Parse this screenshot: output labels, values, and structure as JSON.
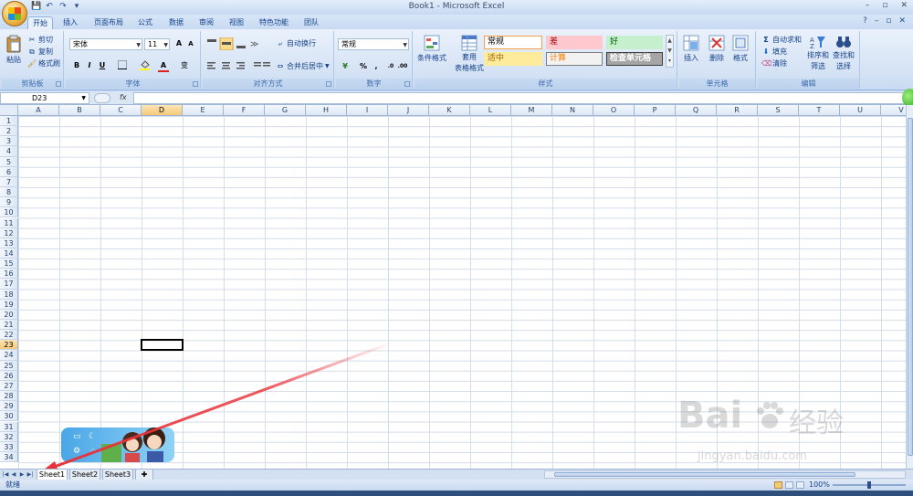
{
  "window": {
    "title": "Book1 - Microsoft Excel",
    "minimize_glyph": "–",
    "restore_glyph": "▫",
    "close_glyph": "✕"
  },
  "quick_access": [
    "💾",
    "↶",
    "↷",
    "▾"
  ],
  "tabs": [
    "开始",
    "插入",
    "页面布局",
    "公式",
    "数据",
    "审阅",
    "视图",
    "特色功能",
    "团队"
  ],
  "active_tab": "开始",
  "help_glyph": "?",
  "groups": {
    "clipboard": {
      "label": "剪贴板",
      "paste": "粘贴",
      "cut": "剪切",
      "copy": "复制",
      "painter": "格式刷"
    },
    "font": {
      "label": "字体",
      "font_name": "宋体",
      "font_size": "11",
      "grow": "A",
      "shrink": "A",
      "bold": "B",
      "italic": "I",
      "underline": "U",
      "font_color_glyph": "A",
      "wen": "变"
    },
    "alignment": {
      "label": "对齐方式",
      "wrap": "自动换行",
      "merge": "合并后居中"
    },
    "number": {
      "label": "数字",
      "format": "常规",
      "percent": "%",
      "comma": ","
    },
    "styles": {
      "label": "样式",
      "conditional": "条件格式",
      "table_line1": "套用",
      "table_line2": "表格格式",
      "cells": [
        {
          "text": "常规",
          "bg": "#ffffff",
          "color": "#000000",
          "border": "#f0a24a"
        },
        {
          "text": "差",
          "bg": "#ffc7ce",
          "color": "#9c0006",
          "border": "#ffc7ce"
        },
        {
          "text": "好",
          "bg": "#c6efce",
          "color": "#006100",
          "border": "#c6efce"
        },
        {
          "text": "适中",
          "bg": "#ffeb9c",
          "color": "#9c6500",
          "border": "#ffeb9c"
        },
        {
          "text": "计算",
          "bg": "#f2f2f2",
          "color": "#fa7d00",
          "border": "#7f7f7f"
        },
        {
          "text": "检查单元格",
          "bg": "#a5a5a5",
          "color": "#ffffff",
          "border": "#3f3f3f"
        }
      ]
    },
    "cells_group": {
      "label": "单元格",
      "insert": "插入",
      "delete": "删除",
      "format": "格式"
    },
    "editing": {
      "label": "编辑",
      "autosum": "自动求和",
      "fill": "填充",
      "clear": "清除",
      "sort_line1": "排序和",
      "sort_line2": "筛选",
      "find_line1": "查找和",
      "find_line2": "选择"
    }
  },
  "formula_bar": {
    "name_box": "D23",
    "fx": "fx",
    "value": ""
  },
  "columns": [
    "A",
    "B",
    "C",
    "D",
    "E",
    "F",
    "G",
    "H",
    "I",
    "J",
    "K",
    "L",
    "M",
    "N",
    "O",
    "P",
    "Q",
    "R",
    "S",
    "T",
    "U",
    "V"
  ],
  "rows": [
    "1",
    "2",
    "3",
    "4",
    "5",
    "6",
    "7",
    "8",
    "9",
    "10",
    "11",
    "12",
    "13",
    "14",
    "15",
    "16",
    "17",
    "18",
    "19",
    "20",
    "21",
    "22",
    "23",
    "24",
    "25",
    "26",
    "27",
    "28",
    "29",
    "30",
    "31",
    "32",
    "33",
    "34"
  ],
  "selected_cell": {
    "col": "D",
    "row": "23"
  },
  "sheets": [
    "Sheet1",
    "Sheet2",
    "Sheet3"
  ],
  "active_sheet": "Sheet1",
  "status": {
    "ready": "就绪",
    "zoom": "100%"
  },
  "watermark": {
    "brand": "Bai",
    "brand2": "经验",
    "url": "jingyan.baidu.com"
  },
  "annotation": {
    "arrow_color": "#e8333a"
  }
}
